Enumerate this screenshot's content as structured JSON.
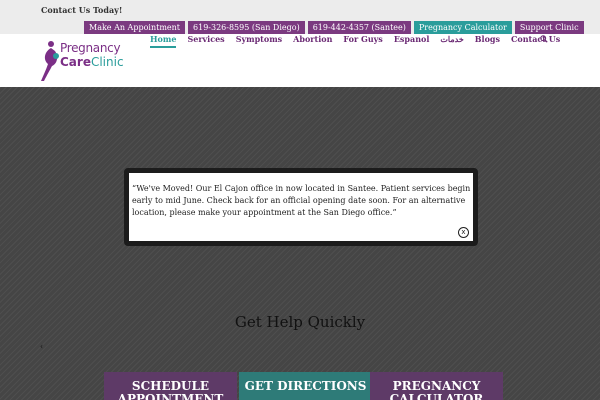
{
  "topbar": {
    "contact_today": "Contact Us Today!",
    "buttons": [
      {
        "label": "Make An Appointment"
      },
      {
        "label": "619-326-8595 (San Diego)"
      },
      {
        "label": "619-442-4357 (Santee)"
      },
      {
        "label": "Pregnancy Calculator"
      },
      {
        "label": "Support Clinic"
      }
    ]
  },
  "logo": {
    "line1": "Pregnancy",
    "line2a": "Care",
    "line2b": "Clinic"
  },
  "nav": {
    "items": [
      "Home",
      "Services",
      "Symptoms",
      "Abortion",
      "For Guys",
      "Espanol",
      "خدمات",
      "Blogs",
      "Contact Us"
    ],
    "search_icon": "search-icon"
  },
  "hero": {
    "help_title": "Get Help Quickly",
    "small_caret": "‹",
    "ctas": [
      "SCHEDULE APPOINTMENT",
      "GET DIRECTIONS",
      "PREGNANCY CALCULATOR"
    ]
  },
  "modal": {
    "text": "“We've Moved! Our El Cajon office in now located in Santee. Patient services begin early to mid June. Check back for an official opening date soon. For an alternative location, please make your appointment at the San Diego office.”",
    "close": "x"
  },
  "colors": {
    "purple": "#7b3a80",
    "teal": "#2a9d9b",
    "nav_text": "#6b2a74"
  }
}
